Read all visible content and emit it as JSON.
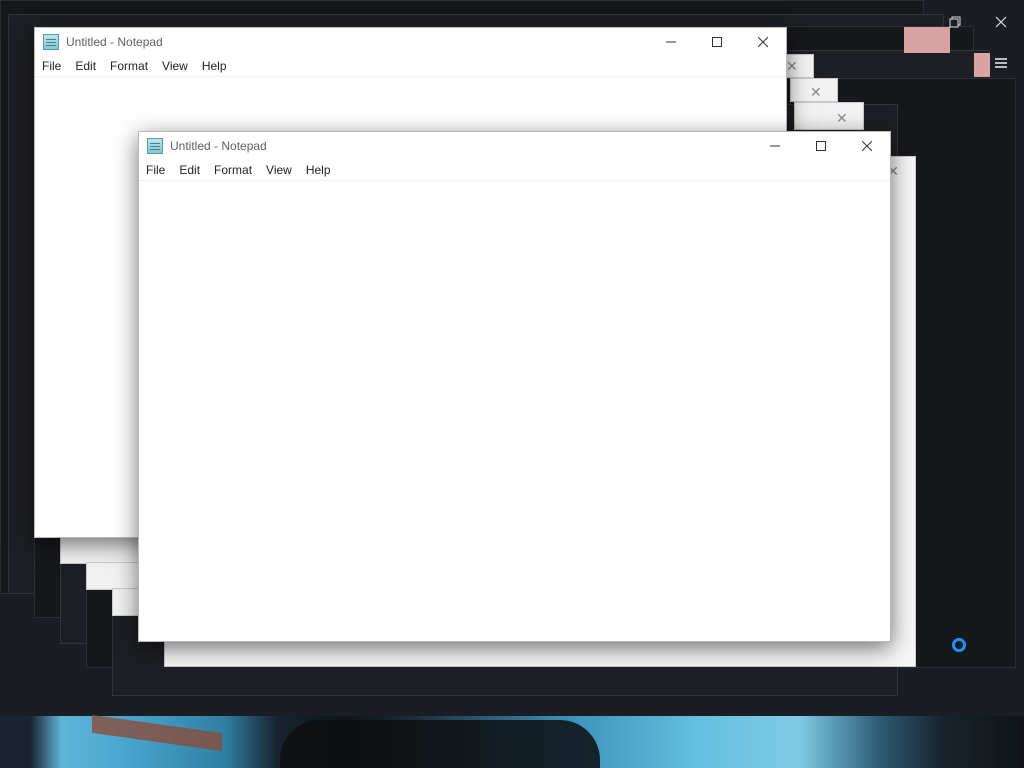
{
  "host": {
    "restore_icon": "restore-icon",
    "close_icon": "close-icon",
    "menu_icon": "hamburger-icon"
  },
  "notepad_back": {
    "title": "Untitled - Notepad",
    "menus": [
      "File",
      "Edit",
      "Format",
      "View",
      "Help"
    ]
  },
  "notepad_front": {
    "title": "Untitled - Notepad",
    "menus": [
      "File",
      "Edit",
      "Format",
      "View",
      "Help"
    ]
  },
  "window_controls": {
    "minimize": "—",
    "maximize": "☐",
    "close": "✕"
  },
  "colors": {
    "desktop": "#1b1d24",
    "accent_cursor": "#1e8fff",
    "close_hover_tint": "#d9a3a3"
  }
}
